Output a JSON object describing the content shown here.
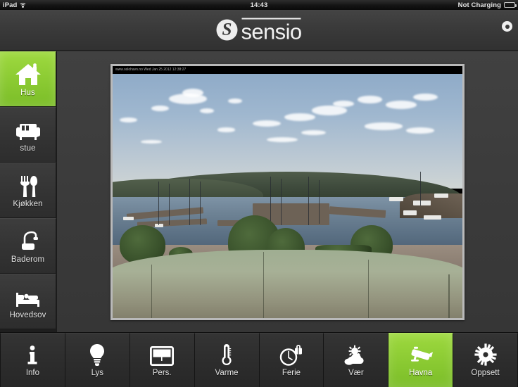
{
  "statusbar": {
    "device": "iPad",
    "wifi_icon": "wifi-icon",
    "time": "14:43",
    "battery_state": "Not Charging",
    "battery_icon": "battery-icon"
  },
  "header": {
    "brand": "sensio",
    "logo_mark_icon": "sensio-s-logo-icon",
    "power_button_icon": "power-icon"
  },
  "sidebar": {
    "items": [
      {
        "label": "Hus",
        "icon": "house-icon",
        "active": true
      },
      {
        "label": "stue",
        "icon": "sofa-icon",
        "active": false
      },
      {
        "label": "Kjøkken",
        "icon": "cutlery-icon",
        "active": false
      },
      {
        "label": "Baderom",
        "icon": "shower-sink-icon",
        "active": false
      },
      {
        "label": "Hovedsov",
        "icon": "bed-icon",
        "active": false
      }
    ]
  },
  "main": {
    "camera": {
      "name": "Havna",
      "overlay_text": "www.oslohavn.no  Wed Jan 25 2012 12:38:27",
      "scene": "Oslo harbour fjord webcam view"
    }
  },
  "toolbar": {
    "items": [
      {
        "label": "Info",
        "icon": "info-icon",
        "active": false
      },
      {
        "label": "Lys",
        "icon": "lightbulb-icon",
        "active": false
      },
      {
        "label": "Pers.",
        "icon": "blinds-icon",
        "active": false
      },
      {
        "label": "Varme",
        "icon": "thermometer-icon",
        "active": false
      },
      {
        "label": "Ferie",
        "icon": "holiday-icon",
        "active": false
      },
      {
        "label": "Vær",
        "icon": "weather-icon",
        "active": false
      },
      {
        "label": "Havna",
        "icon": "cctv-camera-icon",
        "active": true
      },
      {
        "label": "Oppsett",
        "icon": "gear-icon",
        "active": false
      }
    ]
  },
  "colors": {
    "accent_green": "#8ccb33",
    "panel_dark": "#303030",
    "content_bg": "#3b3b3b",
    "text": "#e2e2e2"
  }
}
